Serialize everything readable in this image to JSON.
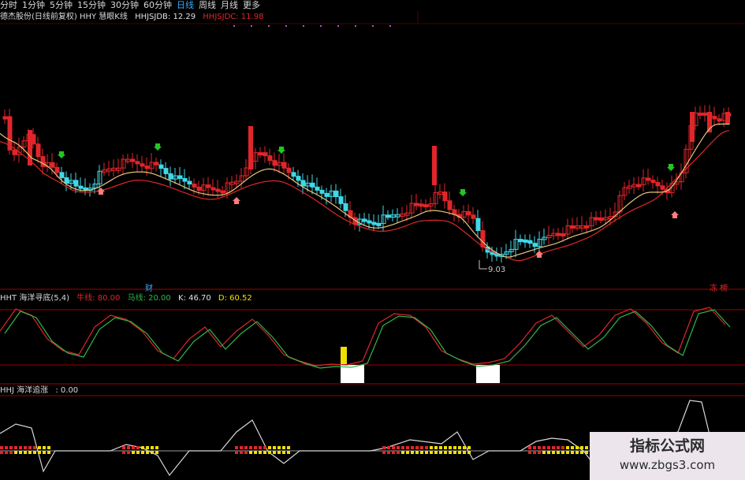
{
  "toolbar": {
    "items": [
      "分时",
      "1分钟",
      "5分钟",
      "15分钟",
      "30分钟",
      "60分钟",
      "日线",
      "周线",
      "月线",
      "更多"
    ],
    "active": "日线"
  },
  "main_header": {
    "title": "德杰股份(日线前复权) HHY 慧眼K线",
    "hhjsjdb_label": "HHJSJDB: 12.29",
    "hhjsjdc_label": "HHJSJDC: 11.98"
  },
  "low_price_label": "9.03",
  "panel_marks": {
    "left": "财",
    "right": "冻 榜"
  },
  "panel2": {
    "title": "HHT 海洋寻底(5,4)",
    "value_a": "牛线: 80.00",
    "value_b": "马线: 20.00",
    "k": "K: 46.70",
    "d": "D: 60.52"
  },
  "panel3": {
    "title": "HHJ 海洋追涨",
    "value": ": 0.00"
  },
  "watermark": {
    "line1": "指标公式网",
    "line2": "www.zbgs3.com"
  },
  "colors": {
    "bg": "#000000",
    "up": "#e0262b",
    "down": "#3fd8e8",
    "ma1": "#e8c67a",
    "ma2": "#e0262b",
    "k": "#e0262b",
    "d": "#2fb84a",
    "arrow_down": "#23c623",
    "arrow_up": "#ff7d7d",
    "fill_yellow": "#f0e000",
    "fill_white": "#ffffff",
    "hhjsjdb": "#e0e0e0",
    "hhjsjdc": "#e0262b",
    "panel2_a": "#e0262b",
    "panel2_b": "#2fb84a",
    "panel2_k": "#e0e0e0",
    "panel2_d": "#f0e000"
  }
}
